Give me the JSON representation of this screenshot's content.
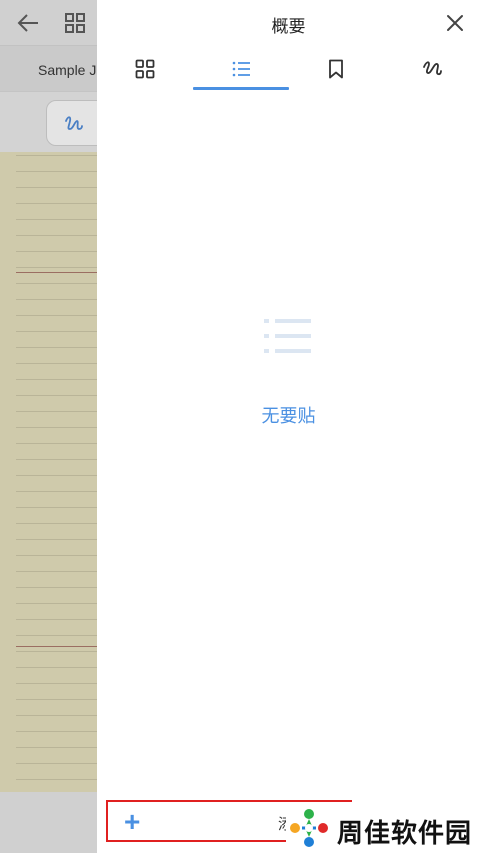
{
  "background": {
    "document_tab": "Sample J",
    "icons": [
      "back-arrow-icon",
      "grid-icon",
      "pen-icon"
    ]
  },
  "panel": {
    "title": "概要",
    "tabs": [
      {
        "name": "thumbnails",
        "icon": "grid-icon",
        "active": false
      },
      {
        "name": "outline",
        "icon": "list-icon",
        "active": true
      },
      {
        "name": "bookmarks",
        "icon": "bookmark-icon",
        "active": false
      },
      {
        "name": "annotations",
        "icon": "scribble-icon",
        "active": false
      }
    ],
    "empty_state": {
      "icon": "list-icon",
      "text": "无要贴"
    },
    "add_bar": {
      "icon": "plus-icon",
      "label": "添"
    }
  },
  "watermark": {
    "text": "周佳软件园"
  },
  "colors": {
    "accent": "#4a90e2",
    "highlight_border": "#e02020",
    "paper": "#cfcaab"
  }
}
